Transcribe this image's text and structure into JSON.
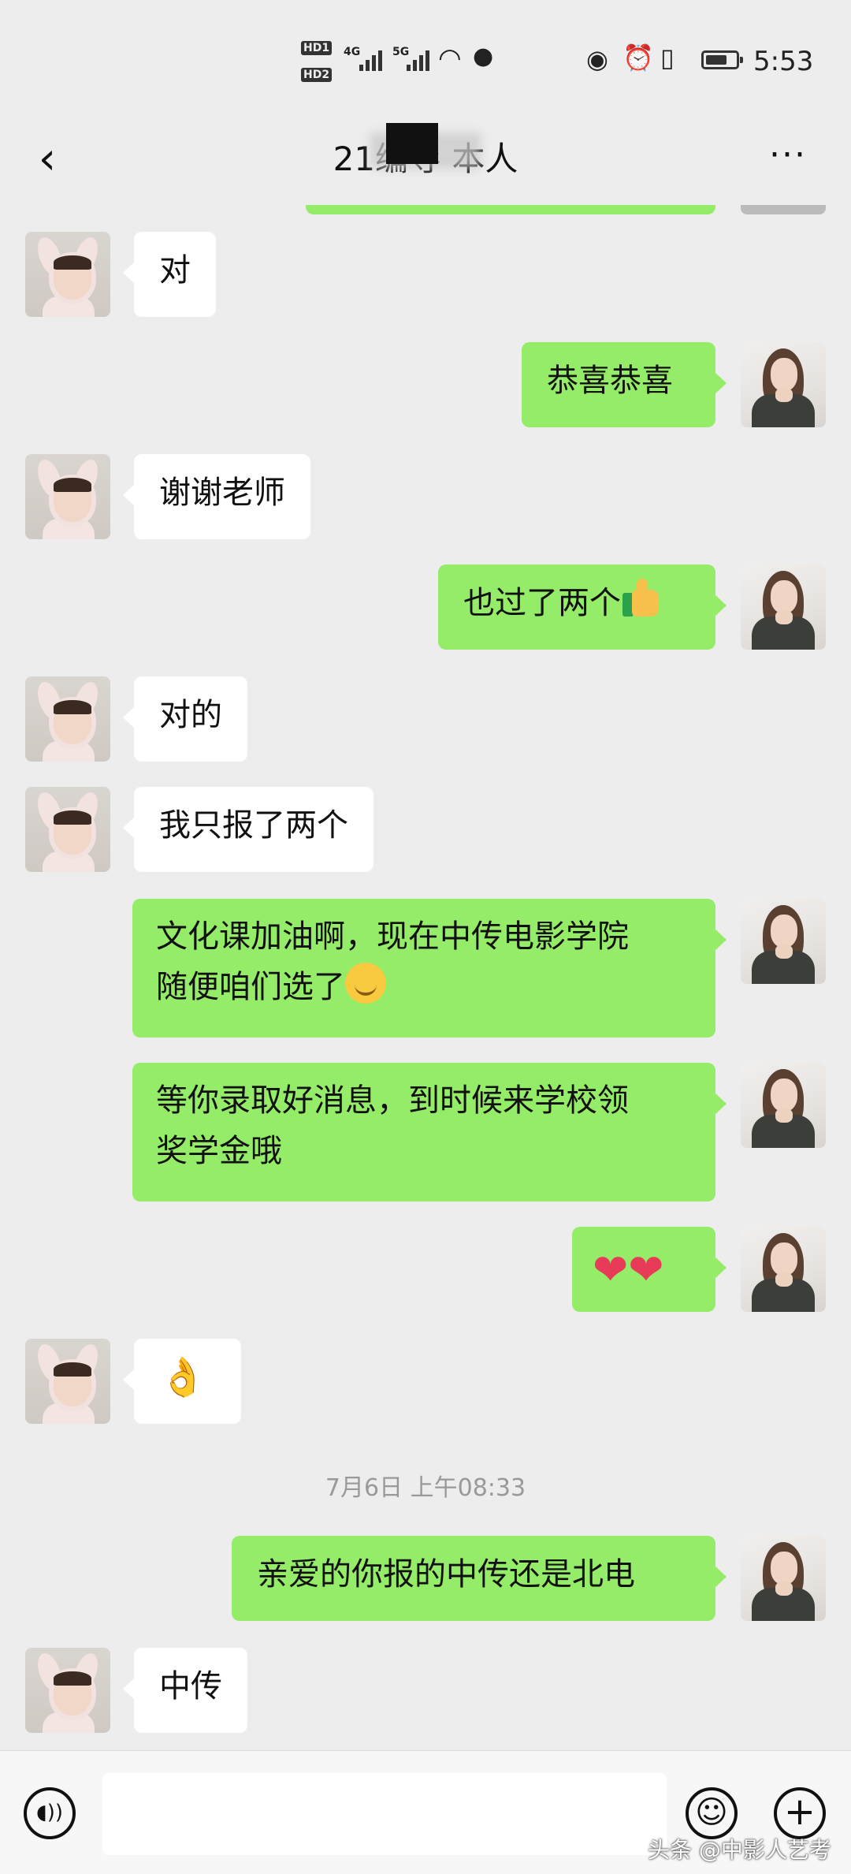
{
  "status_bar": {
    "hd1": "HD1",
    "hd2": "HD2",
    "net1": "4G",
    "net2": "5G",
    "time": "5:53"
  },
  "header": {
    "title": "21编导        本人",
    "back_icon": "chevron-left-icon",
    "more_icon": "more-horizontal-icon"
  },
  "messages": [
    {
      "side": "left",
      "text": "对"
    },
    {
      "side": "right",
      "text": "恭喜恭喜"
    },
    {
      "side": "left",
      "text": "谢谢老师"
    },
    {
      "side": "right",
      "text": "也过了两个",
      "emoji": "thumbs-up-icon"
    },
    {
      "side": "left",
      "text": "对的"
    },
    {
      "side": "left",
      "text": "我只报了两个"
    },
    {
      "side": "right",
      "text_line1": "文化课加油啊，现在中传电影学院",
      "text_line2": "随便咱们选了",
      "emoji": "grinning-face-icon"
    },
    {
      "side": "right",
      "text_line1": "等你录取好消息，到时候来学校领",
      "text_line2": "奖学金哦"
    },
    {
      "side": "right",
      "text": "❤❤",
      "emoji": "hearts-icon"
    },
    {
      "side": "left",
      "text": "👌",
      "emoji": "ok-hand-icon"
    },
    {
      "side": "right",
      "text": "亲爱的你报的中传还是北电"
    },
    {
      "side": "left",
      "text": "中传"
    }
  ],
  "timestamp": "7月6日 上午08:33",
  "input_bar": {
    "placeholder": "",
    "voice_icon": "voice-icon",
    "emoji_icon": "smile-icon",
    "plus_icon": "plus-icon"
  },
  "watermark": "头条 @中影人艺考",
  "colors": {
    "background": "#ededed",
    "sent_bubble": "#95ec69",
    "received_bubble": "#ffffff"
  }
}
